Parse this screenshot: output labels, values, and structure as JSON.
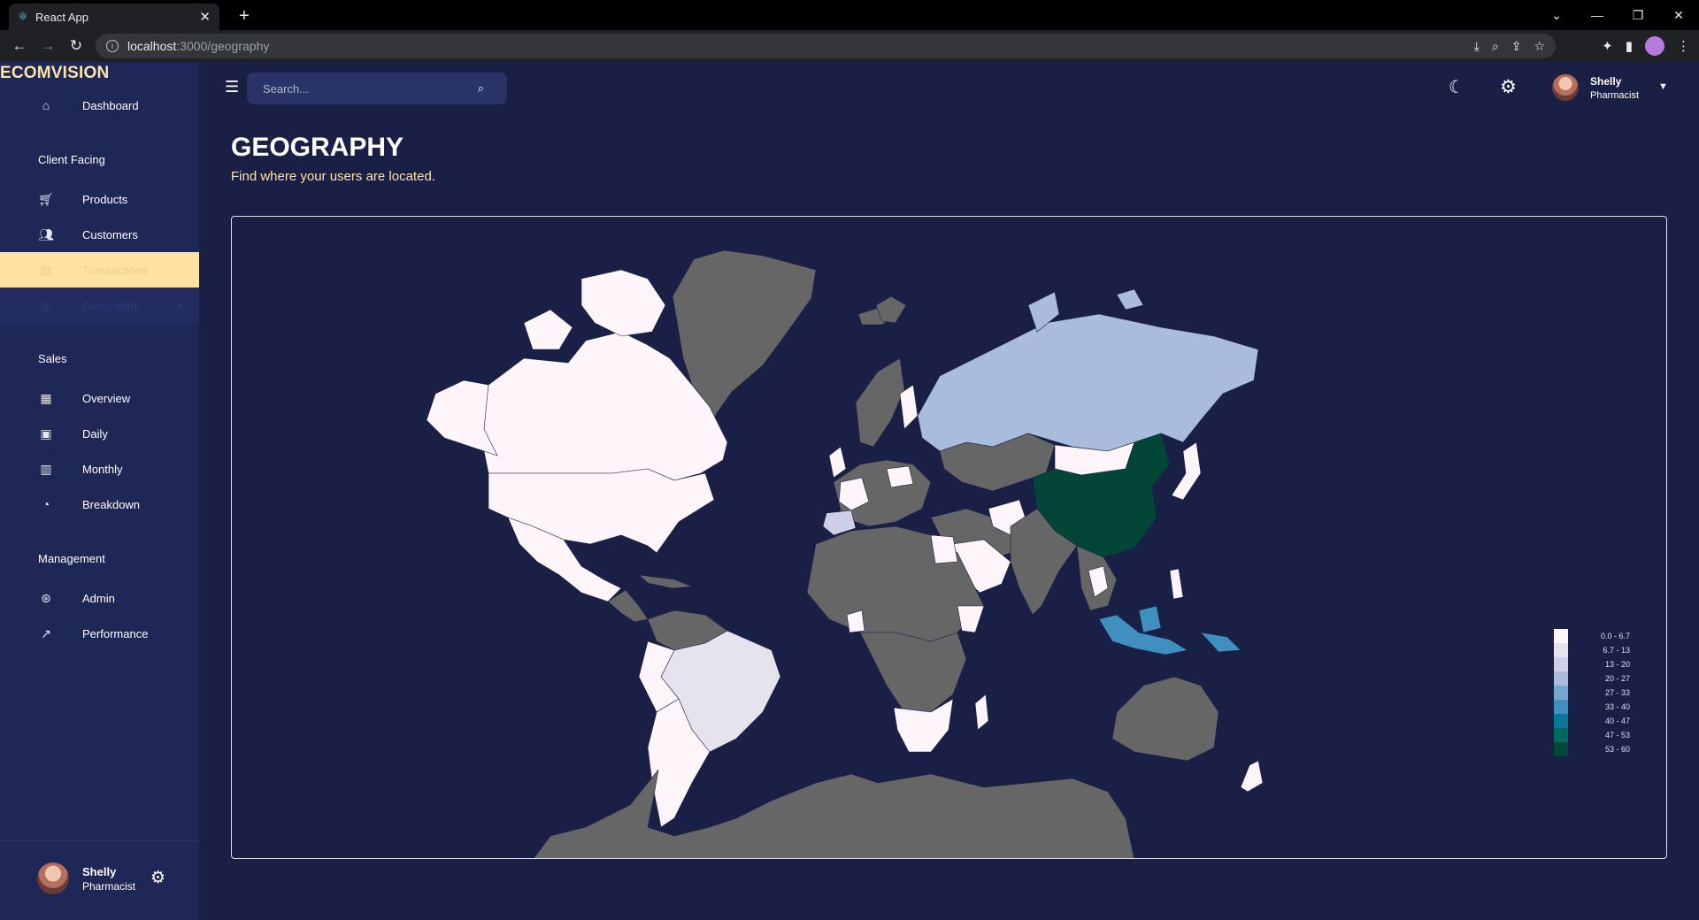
{
  "browser": {
    "tab_title": "React App",
    "url_host": "localhost",
    "url_path": ":3000/geography"
  },
  "brand": "ECOMVISION",
  "sidebar": {
    "items": [
      {
        "label": "Dashboard",
        "icon": "home-icon"
      },
      {
        "label": "Products",
        "icon": "cart-icon"
      },
      {
        "label": "Customers",
        "icon": "group-icon"
      },
      {
        "label": "Transactions",
        "icon": "receipt-icon"
      },
      {
        "label": "Geography",
        "icon": "globe-icon"
      },
      {
        "label": "Overview",
        "icon": "point-of-sale-icon"
      },
      {
        "label": "Daily",
        "icon": "calendar-today-icon"
      },
      {
        "label": "Monthly",
        "icon": "calendar-month-icon"
      },
      {
        "label": "Breakdown",
        "icon": "pie-chart-icon"
      },
      {
        "label": "Admin",
        "icon": "admin-icon"
      },
      {
        "label": "Performance",
        "icon": "trending-up-icon"
      }
    ],
    "sections": [
      "Client Facing",
      "Sales",
      "Management"
    ],
    "footer": {
      "name": "Shelly",
      "role": "Pharmacist"
    }
  },
  "topbar": {
    "search_placeholder": "Search...",
    "user_name": "Shelly",
    "user_role": "Pharmacist"
  },
  "page": {
    "title": "GEOGRAPHY",
    "subtitle": "Find where your users are located."
  },
  "map": {
    "legend": [
      {
        "label": "0.0 - 6.7",
        "color": "#fdf5fa"
      },
      {
        "label": "6.7 - 13",
        "color": "#e6e3ee"
      },
      {
        "label": "13 - 20",
        "color": "#cdd0e5"
      },
      {
        "label": "20 - 27",
        "color": "#a9bcdb"
      },
      {
        "label": "27 - 33",
        "color": "#74a9cf"
      },
      {
        "label": "33 - 40",
        "color": "#3f90bf"
      },
      {
        "label": "40 - 47",
        "color": "#08789a"
      },
      {
        "label": "47 - 53",
        "color": "#016a5e"
      },
      {
        "label": "53 - 60",
        "color": "#014636"
      }
    ],
    "no_data_color": "#666666"
  }
}
